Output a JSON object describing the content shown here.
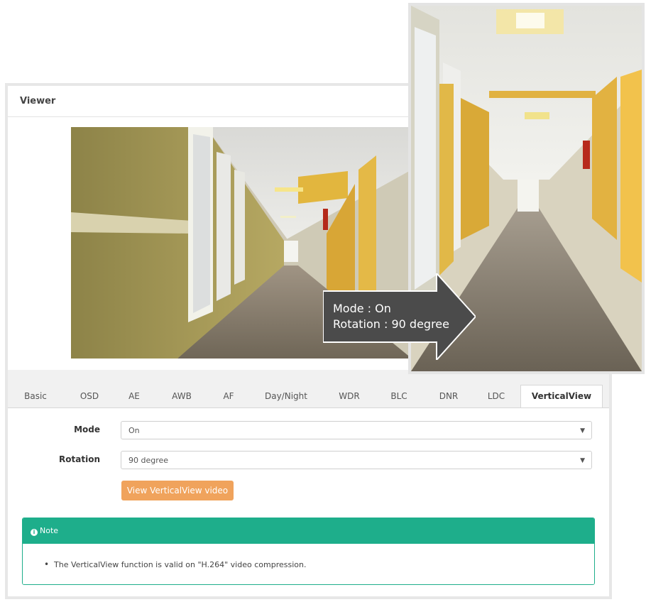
{
  "viewer": {
    "title": "Viewer"
  },
  "tabs": [
    "Basic",
    "OSD",
    "AE",
    "AWB",
    "AF",
    "Day/Night",
    "WDR",
    "BLC",
    "DNR",
    "LDC",
    "VerticalView"
  ],
  "active_tab": "VerticalView",
  "form": {
    "mode": {
      "label": "Mode",
      "value": "On"
    },
    "rotation": {
      "label": "Rotation",
      "value": "90 degree"
    },
    "view_button": "View VerticalView video"
  },
  "note": {
    "icon": "info-icon",
    "title": "Note",
    "items": [
      "The VerticalView function is valid on \"H.264\" video compression."
    ]
  },
  "callout": {
    "line1": "Mode : On",
    "line2": "Rotation : 90 degree"
  },
  "colors": {
    "accent_orange": "#f0a35c",
    "note_green": "#1eae8b",
    "callout_gray": "#4b4b4b"
  }
}
